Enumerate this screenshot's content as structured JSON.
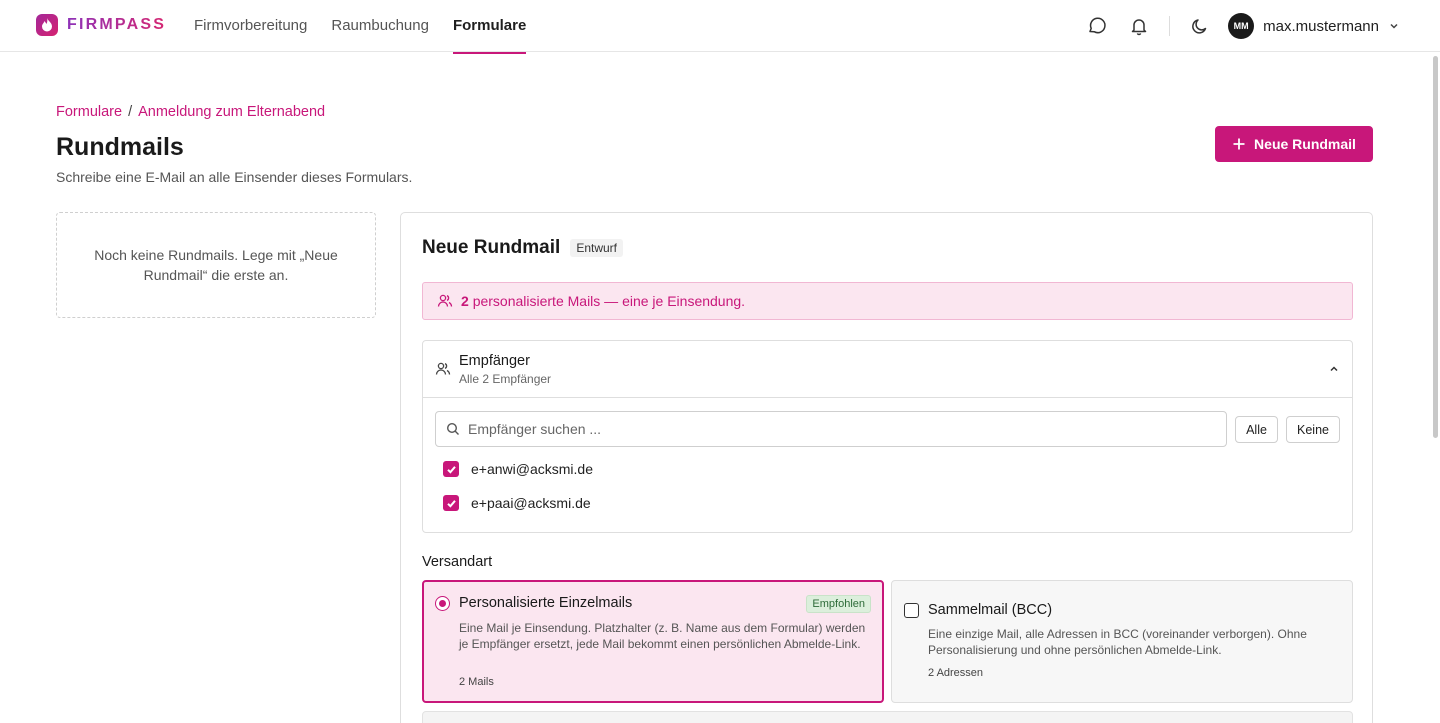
{
  "app": {
    "name": "FIRMPASS"
  },
  "nav": {
    "items": [
      {
        "label": "Firmvorbereitung"
      },
      {
        "label": "Raumbuchung"
      },
      {
        "label": "Formulare"
      }
    ],
    "active": "Formulare"
  },
  "user": {
    "initials": "MM",
    "name": "max.mustermann"
  },
  "breadcrumb": {
    "root": "Formulare",
    "separator": "/",
    "current": "Anmeldung zum Elternabend"
  },
  "page": {
    "title": "Rundmails",
    "subtitle": "Schreibe eine E-Mail an alle Einsender dieses Formulars.",
    "new_button": "Neue Rundmail"
  },
  "empty_state": "Noch keine Rundmails. Lege mit „Neue Rundmail“ die erste an.",
  "editor": {
    "title": "Neue Rundmail",
    "status_badge": "Entwurf",
    "banner": {
      "count": "2",
      "text": "personalisierte Mails — eine je Einsendung."
    },
    "recipients": {
      "title": "Empfänger",
      "summary": "Alle 2 Empfänger",
      "search_placeholder": "Empfänger suchen ...",
      "all_label": "Alle",
      "none_label": "Keine",
      "list": [
        {
          "email": "e+anwi@acksmi.de",
          "checked": true
        },
        {
          "email": "e+paai@acksmi.de",
          "checked": true
        }
      ]
    },
    "versandart": {
      "label": "Versandart",
      "options": [
        {
          "title": "Personalisierte Einzelmails",
          "badge": "Empfohlen",
          "description": "Eine Mail je Einsendung. Platzhalter (z. B. Name aus dem Formular) werden je Empfänger ersetzt, jede Mail bekommt einen persönlichen Abmelde-Link.",
          "count": "2 Mails",
          "selected": true
        },
        {
          "title": "Sammelmail (BCC)",
          "description": "Eine einzige Mail, alle Adressen in BCC (voreinander verborgen). Ohne Personalisierung und ohne persönlichen Abmelde-Link.",
          "count": "2 Adressen",
          "selected": false
        }
      ]
    }
  },
  "colors": {
    "accent": "#c8177a",
    "accent_bg": "#fbe6f0",
    "success_badge": "#dcefdc"
  }
}
